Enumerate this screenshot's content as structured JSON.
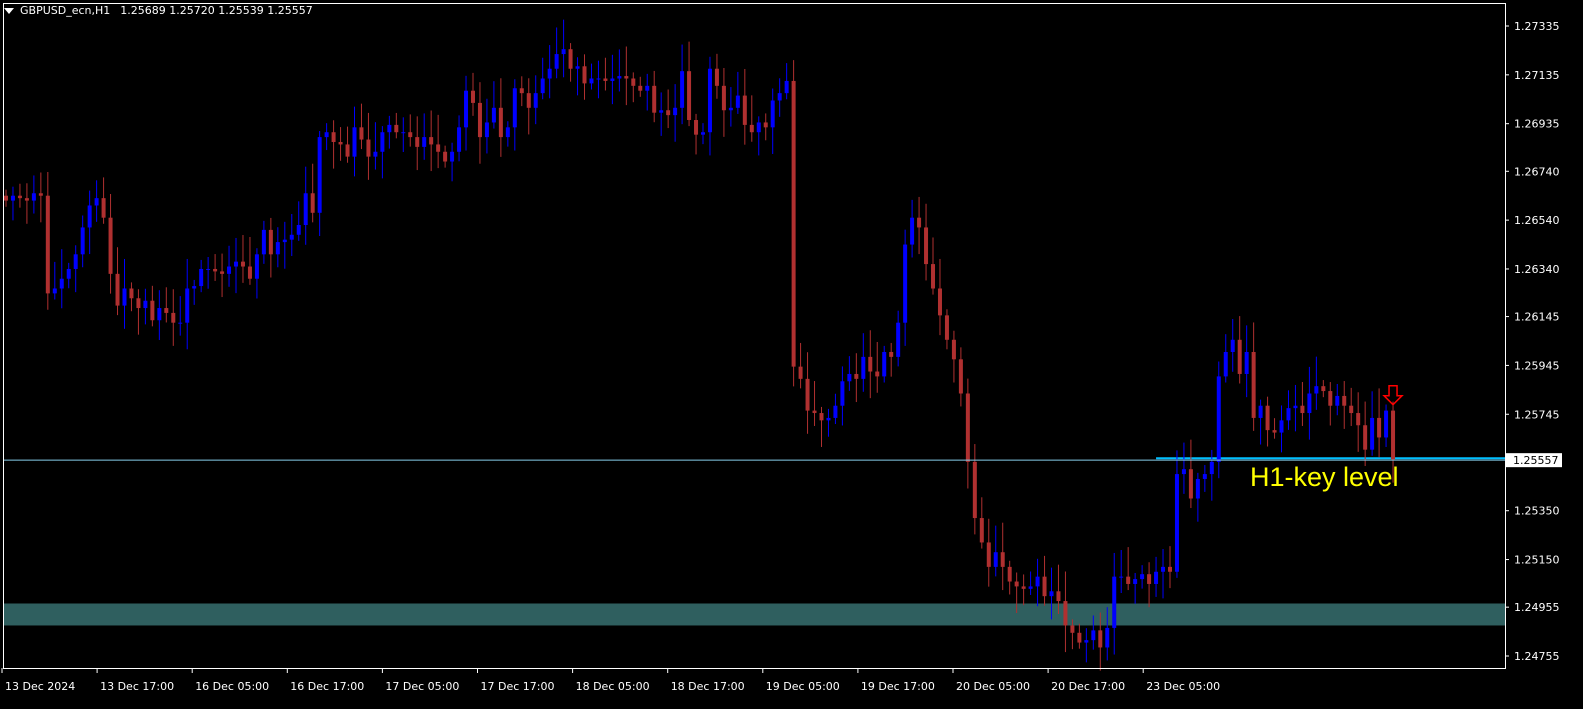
{
  "header": {
    "symbol": "GBPUSD_ecn,H1",
    "ohlc": "1.25689 1.25720 1.25539 1.25557"
  },
  "colors": {
    "background": "#000000",
    "bull": "#0000ff",
    "bear": "#b03030",
    "price_line": "#87ceeb",
    "key_level": "#00bfff",
    "zone": "#2f5f5f",
    "annotation": "#ffff00",
    "arrow": "#ff0000"
  },
  "annotation": {
    "text": "H1-key level"
  },
  "icons": {
    "signal": "down-arrow-icon"
  },
  "chart_data": {
    "type": "candlestick",
    "title": "",
    "symbol": "GBPUSD_ecn",
    "timeframe": "H1",
    "y_ticks": [
      "1.27335",
      "1.27135",
      "1.26935",
      "1.26740",
      "1.26540",
      "1.26340",
      "1.26145",
      "1.25945",
      "1.25745",
      "1.25350",
      "1.25150",
      "1.24955",
      "1.24755"
    ],
    "x_ticks": [
      "13 Dec 2024",
      "13 Dec 17:00",
      "16 Dec 05:00",
      "16 Dec 17:00",
      "17 Dec 05:00",
      "17 Dec 17:00",
      "18 Dec 05:00",
      "18 Dec 17:00",
      "19 Dec 05:00",
      "19 Dec 17:00",
      "20 Dec 05:00",
      "20 Dec 17:00",
      "23 Dec 05:00"
    ],
    "ylim": [
      1.2469,
      1.275
    ],
    "current_price": {
      "label": "1.25557",
      "value": 1.25557
    },
    "key_level": {
      "value": 1.25565,
      "start_bar": 165,
      "end_bar": 220
    },
    "support_zone": {
      "low": 1.2488,
      "high": 1.2497
    },
    "signal": {
      "type": "sell",
      "bar": 199,
      "price": 1.2578
    },
    "last_close": 1.25557,
    "hourly_closes": [
      1.2662,
      1.2664,
      1.2663,
      1.2662,
      1.2665,
      1.2664,
      1.2624,
      1.2626,
      1.263,
      1.2634,
      1.264,
      1.2651,
      1.266,
      1.2663,
      1.2655,
      1.2632,
      1.2619,
      1.2626,
      1.2622,
      1.2618,
      1.2621,
      1.2613,
      1.2618,
      1.2616,
      1.2612,
      1.2612,
      1.2626,
      1.2627,
      1.2634,
      1.2634,
      1.2633,
      1.2632,
      1.2635,
      1.2637,
      1.2635,
      1.263,
      1.264,
      1.265,
      1.264,
      1.2645,
      1.2646,
      1.2648,
      1.2652,
      1.2665,
      1.2657,
      1.2688,
      1.269,
      1.2686,
      1.2685,
      1.268,
      1.2692,
      1.2687,
      1.268,
      1.2682,
      1.269,
      1.2693,
      1.269,
      1.269,
      1.2688,
      1.2684,
      1.2688,
      1.2685,
      1.2682,
      1.2678,
      1.2682,
      1.2692,
      1.2707,
      1.2702,
      1.2688,
      1.2694,
      1.27,
      1.2688,
      1.2692,
      1.2708,
      1.2706,
      1.27,
      1.2706,
      1.2712,
      1.2716,
      1.2722,
      1.2724,
      1.2716,
      1.2717,
      1.271,
      1.2712,
      1.2712,
      1.2711,
      1.2712,
      1.2713,
      1.2712,
      1.2709,
      1.2707,
      1.2709,
      1.2698,
      1.2699,
      1.2697,
      1.27,
      1.2715,
      1.2695,
      1.2689,
      1.269,
      1.2716,
      1.2709,
      1.2699,
      1.27,
      1.2705,
      1.2693,
      1.269,
      1.2694,
      1.2692,
      1.2703,
      1.2706,
      1.2711,
      1.2594,
      1.2589,
      1.2576,
      1.2575,
      1.2572,
      1.2573,
      1.2578,
      1.2588,
      1.2591,
      1.2589,
      1.2598,
      1.2592,
      1.259,
      1.26,
      1.2598,
      1.2612,
      1.2644,
      1.2655,
      1.2651,
      1.2636,
      1.2626,
      1.2615,
      1.2605,
      1.2597,
      1.2583,
      1.2555,
      1.2532,
      1.2522,
      1.2512,
      1.2518,
      1.2512,
      1.2506,
      1.2504,
      1.2503,
      1.2504,
      1.2508,
      1.25,
      1.2502,
      1.2498,
      1.2488,
      1.2485,
      1.2481,
      1.2482,
      1.2486,
      1.2479,
      1.2487,
      1.2508,
      1.2508,
      1.2505,
      1.2507,
      1.2509,
      1.2505,
      1.251,
      1.2512,
      1.251,
      1.255,
      1.2552,
      1.254,
      1.2548,
      1.255,
      1.2555,
      1.259,
      1.26,
      1.2605,
      1.2591,
      1.26,
      1.2573,
      1.2578,
      1.2568,
      1.2567,
      1.2572,
      1.2577,
      1.2578,
      1.2575,
      1.2583,
      1.2586,
      1.2584,
      1.2578,
      1.2582,
      1.2578,
      1.2575,
      1.257,
      1.256,
      1.2573,
      1.2565,
      1.2576,
      1.2556
    ]
  }
}
